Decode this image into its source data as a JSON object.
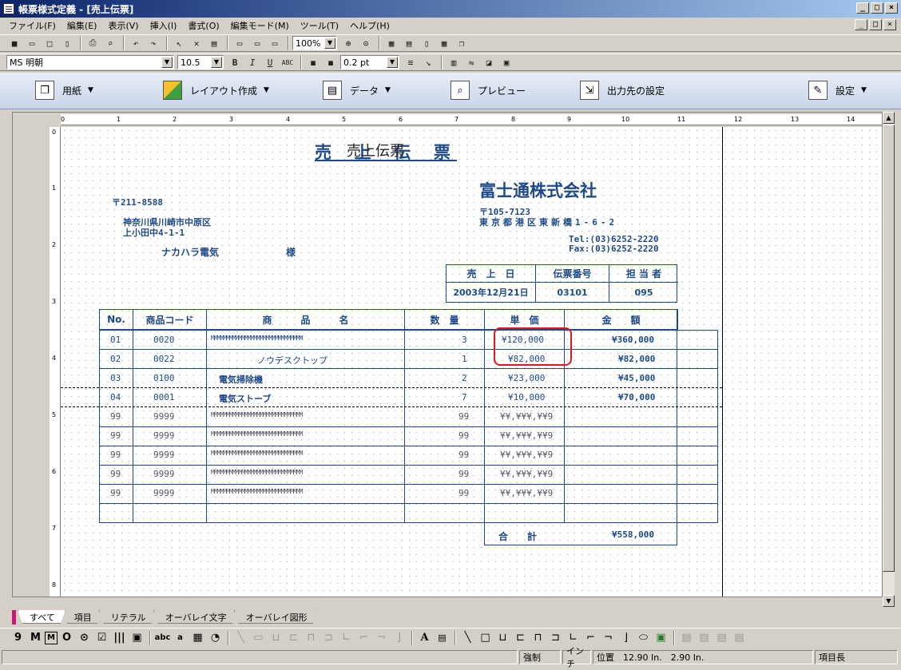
{
  "window": {
    "title": "帳票様式定義 - [売上伝票]",
    "min": "_",
    "max": "□",
    "close": "×"
  },
  "menu": [
    "ファイル(F)",
    "編集(E)",
    "表示(V)",
    "挿入(I)",
    "書式(O)",
    "編集モード(M)",
    "ツール(T)",
    "ヘルプ(H)"
  ],
  "toolbar": {
    "zoom": "100%",
    "font_name": "MS 明朝",
    "font_size": "10.5",
    "bold": "B",
    "italic": "I",
    "underline": "U",
    "abc": "ABC",
    "line_width": "0.2 pt"
  },
  "bigbar": {
    "paper": "用紙",
    "layout": "レイアウト作成",
    "data": "データ",
    "preview": "プレビュー",
    "output": "出力先の設定",
    "settings": "設定"
  },
  "ruler": {
    "top": [
      "0",
      "1",
      "2",
      "3",
      "4",
      "5",
      "6",
      "7",
      "8",
      "9",
      "10",
      "11",
      "12",
      "13",
      "14"
    ],
    "left": [
      "0",
      "1",
      "2",
      "3",
      "4",
      "5",
      "6",
      "7",
      "8"
    ]
  },
  "report": {
    "title_main": "売 上 伝 票",
    "title_overlay": "売上伝票",
    "company": "富士通株式会社",
    "to_zip": "〒211-8588",
    "to_addr1": "神奈川県川崎市中原区",
    "to_addr2": "上小田中4-1-1",
    "to_name": "ナカハラ電気",
    "to_sama": "様",
    "from_zip": "〒105-7123",
    "from_addr": "東京都港区東新橋1-6-2",
    "tel": "Tel:(03)6252-2220",
    "fax": "Fax:(03)6252-2220",
    "info_headers": [
      "売　上　日",
      "伝票番号",
      "担 当 者"
    ],
    "info_values": [
      "2003年12月21日",
      "03101",
      "095"
    ],
    "columns": [
      "No.",
      "商品コード",
      "商　　　品　　　名",
      "数　量",
      "単　価",
      "金　　額"
    ],
    "rows": [
      {
        "no": "01",
        "code": "0020",
        "name": "MMMMMMMMMMMMMMMMMMMMMMMMMMMMMM",
        "qty": "3",
        "price": "¥120,000",
        "amount": "¥360,000"
      },
      {
        "no": "02",
        "code": "0022",
        "name": "ノウデスクトップ",
        "qty": "1",
        "price": "¥82,000",
        "amount": "¥82,000"
      },
      {
        "no": "03",
        "code": "0100",
        "name": "電気掃除機",
        "qty": "2",
        "price": "¥23,000",
        "amount": "¥45,000"
      },
      {
        "no": "04",
        "code": "0001",
        "name": "電気ストーブ",
        "qty": "7",
        "price": "¥10,000",
        "amount": "¥70,000"
      }
    ],
    "placeholder_row": {
      "no": "99",
      "code": "9999",
      "name": "MMMMMMMMMMMMMMMMMMMMMMMMMMMMMM",
      "qty": "99",
      "price": "¥¥,¥¥¥,¥¥9"
    },
    "total_label": "合　　計",
    "total_value": "¥558,000"
  },
  "tabs": [
    "すべて",
    "項目",
    "リテラル",
    "オーバレイ文字",
    "オーバレイ図形"
  ],
  "bottom_tools": [
    "9",
    "M",
    "M",
    "O",
    "⊙",
    "☑",
    "|||",
    "▣",
    "abc",
    "a",
    "▦",
    "◔",
    "A",
    "▤"
  ],
  "status": {
    "mode": "強制",
    "unit": "インチ",
    "position": "位置　12.90 In.　2.90 In.",
    "field": "項目長"
  },
  "colors": {
    "report_blue": "#1e4a8a",
    "highlight_red": "#e01818"
  }
}
